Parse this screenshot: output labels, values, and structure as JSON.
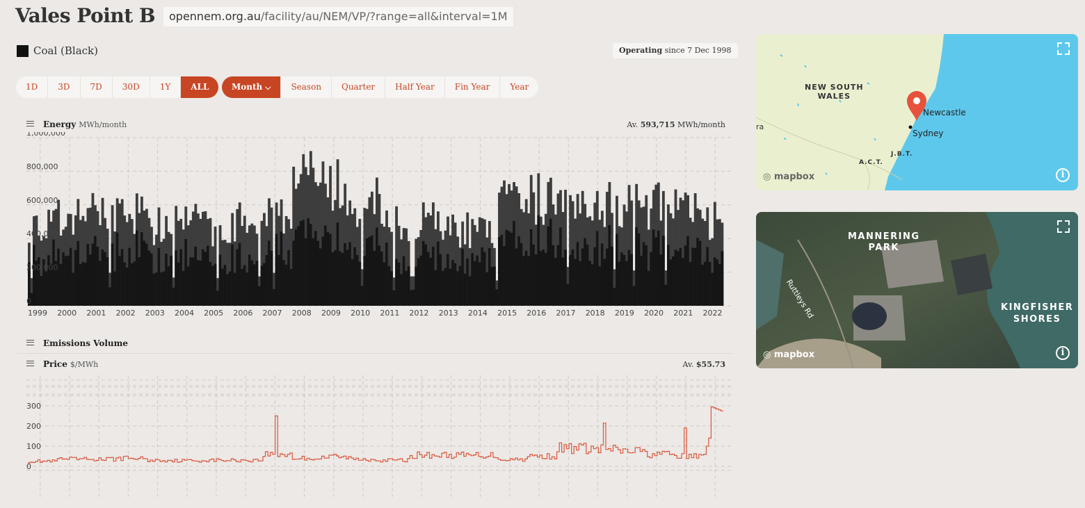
{
  "header": {
    "title": "Vales Point B",
    "url_domain": "opennem.org.au",
    "url_path": "/facility/au/NEM/VP/?range=all&interval=1M"
  },
  "facility": {
    "fuel_label": "Coal (Black)",
    "fuel_color": "#111111",
    "status": "Operating",
    "since": "since 7 Dec 1998"
  },
  "range_tabs": [
    "1D",
    "3D",
    "7D",
    "30D",
    "1Y",
    "ALL"
  ],
  "range_selected": "ALL",
  "interval_tabs": [
    "Month",
    "Season",
    "Quarter",
    "Half Year",
    "Fin Year",
    "Year"
  ],
  "interval_selected": "Month",
  "accent_color": "#c74523",
  "energy": {
    "label": "Energy",
    "unit": "MWh/month",
    "avg_prefix": "Av.",
    "avg_value": "593,715",
    "avg_unit": "MWh/month"
  },
  "emissions": {
    "label": "Emissions Volume"
  },
  "price": {
    "label": "Price",
    "unit": "$/MWh",
    "avg_prefix": "Av.",
    "avg_value": "$55.73"
  },
  "chart_data": [
    {
      "type": "bar",
      "ylim": [
        0,
        1000000
      ],
      "yticks": [
        "0",
        "200,000",
        "400,000",
        "600,000",
        "800,000",
        "1,000,000"
      ],
      "ytick_values": [
        0,
        200000,
        400000,
        600000,
        800000,
        1000000
      ],
      "xticks": [
        "1999",
        "2000",
        "2001",
        "2002",
        "2003",
        "2004",
        "2005",
        "2006",
        "2007",
        "2008",
        "2009",
        "2010",
        "2011",
        "2012",
        "2013",
        "2014",
        "2015",
        "2016",
        "2017",
        "2018",
        "2019",
        "2020",
        "2021",
        "2022"
      ],
      "grid": true,
      "annual_avg_mwh_per_month": [
        470000,
        520000,
        560000,
        560000,
        480000,
        500000,
        470000,
        500000,
        560000,
        760000,
        700000,
        620000,
        480000,
        500000,
        460000,
        430000,
        600000,
        640000,
        660000,
        620000,
        600000,
        600000,
        560000,
        520000
      ]
    },
    {
      "type": "line",
      "ylim": [
        -20,
        350
      ],
      "yticks": [
        "0",
        "100",
        "200",
        "300"
      ],
      "ytick_values": [
        0,
        100,
        200,
        300
      ],
      "grid": true,
      "series_color": "#d9573d",
      "annual_avg_price": [
        25,
        35,
        35,
        40,
        30,
        28,
        30,
        30,
        60,
        40,
        45,
        35,
        30,
        55,
        55,
        55,
        35,
        50,
        90,
        85,
        75,
        60,
        50,
        300
      ]
    }
  ],
  "maps": {
    "mapbox_label": "mapbox",
    "region_labels": [
      "NEW SOUTH",
      "WALES",
      "A.C.T.",
      "J.B.T.",
      "ra"
    ],
    "city_labels": [
      "Newcastle",
      "Sydney"
    ],
    "satellite_labels": [
      "MANNERING",
      "PARK",
      "KINGFISHER",
      "SHORES",
      "Ruttleys Rd"
    ],
    "info_glyph": "i",
    "land_color": "#eaf0cf",
    "sea_color": "#5ec8ec"
  }
}
